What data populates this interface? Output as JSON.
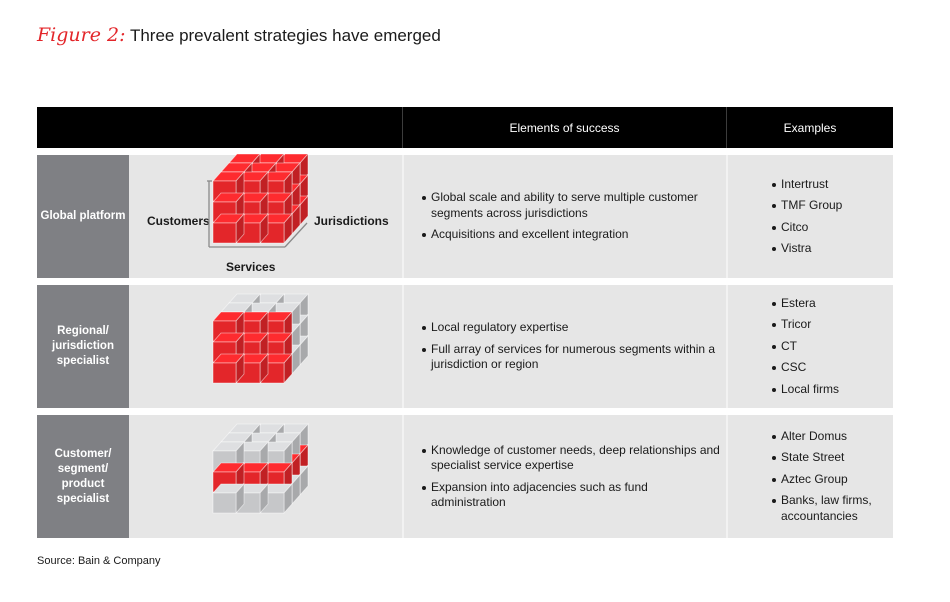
{
  "title": {
    "figure_label": "Figure 2:",
    "text": "Three prevalent strategies have emerged"
  },
  "header": {
    "columns": [
      "",
      "Elements of success",
      "Examples"
    ]
  },
  "colors": {
    "accent_red": "#e3262a",
    "cube_gray": "#c6c7c9",
    "label_gray": "#7f8084",
    "cell_bg": "#e6e6e6",
    "header_bg": "#000000"
  },
  "rows": [
    {
      "label": "Global platform",
      "cube_highlight": "all",
      "axes": {
        "vertical": "Customers",
        "horizontal": "Services",
        "depth": "Jurisdictions"
      },
      "elements": [
        "Global scale and ability to serve multiple customer segments across jurisdictions",
        "Acquisitions and excellent integration"
      ],
      "examples": [
        "Intertrust",
        "TMF Group",
        "Citco",
        "Vistra"
      ]
    },
    {
      "label": "Regional/ jurisdiction specialist",
      "cube_highlight": "front-layer",
      "elements": [
        "Local regulatory expertise",
        "Full array of services for numerous segments within a jurisdiction or region"
      ],
      "examples": [
        "Estera",
        "Tricor",
        "CT",
        "CSC",
        "Local firms"
      ]
    },
    {
      "label": "Customer/ segment/ product specialist",
      "cube_highlight": "middle-row",
      "elements": [
        "Knowledge of customer needs, deep relationships and specialist service expertise",
        "Expansion into adjacencies such as fund administration"
      ],
      "examples": [
        "Alter Domus",
        "State Street",
        "Aztec Group",
        "Banks, law firms, accountancies"
      ]
    }
  ],
  "source": "Source: Bain & Company"
}
